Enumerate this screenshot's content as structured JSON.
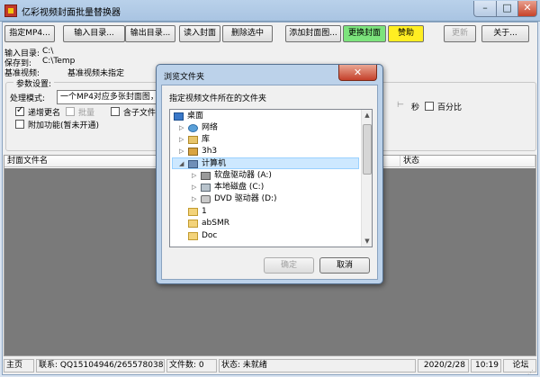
{
  "window": {
    "title": "亿彩视频封面批量替换器",
    "minimize_glyph": "–",
    "maximize_glyph": "□",
    "close_glyph": "✕"
  },
  "toolbar": {
    "buttons": [
      {
        "label": "指定MP4..."
      },
      {
        "label": "输入目录..."
      },
      {
        "label": "输出目录..."
      },
      {
        "label": "读入封面"
      },
      {
        "label": "删除选中"
      },
      {
        "label": "添加封面图..."
      },
      {
        "label": "更换封面",
        "color": "#7ce37c"
      },
      {
        "label": "赞助",
        "color": "#ffee22"
      },
      {
        "label": "更新",
        "disabled": true
      },
      {
        "label": "关于..."
      }
    ]
  },
  "paths": {
    "input_label": "输入目录:",
    "input_value": "C:\\",
    "output_label": "保存到:",
    "output_value": "C:\\Temp",
    "base_video_label": "基准视频:",
    "base_video_value": "基准视频未指定"
  },
  "settings": {
    "group_title": "参数设置:",
    "mode_label": "处理模式:",
    "mode_value": "一个MP4对应多张封面图，生",
    "auto_rename_label": "递增更名",
    "auto_rename_checked": true,
    "batch_label": "批量",
    "batch_checked": false,
    "include_subdirs_label": "含子文件夹",
    "include_subdirs_checked": false,
    "seconds_label": "秒",
    "percent_label": "百分比",
    "percent_checked": false,
    "addon_label": "附加功能(暂未开通)",
    "addon_checked": false
  },
  "list": {
    "columns": [
      "封面文件名",
      "状态"
    ]
  },
  "statusbar": {
    "home": "主页",
    "contact": "联系: QQ15104946/2655780380»",
    "file_count": "文件数: 0",
    "state": "状态: 未就绪",
    "date": "2020/2/28",
    "time": "10:19",
    "forum": "论坛"
  },
  "dialog": {
    "title": "浏览文件夹",
    "prompt": "指定视频文件所在的文件夹",
    "tree": [
      {
        "label": "桌面",
        "icon": "desktop-icon",
        "level": 0,
        "arrow": ""
      },
      {
        "label": "网络",
        "icon": "network-icon",
        "level": 1,
        "arrow": "▷"
      },
      {
        "label": "库",
        "icon": "library-icon",
        "level": 1,
        "arrow": "▷"
      },
      {
        "label": "3h3",
        "icon": "user-folder-icon",
        "level": 1,
        "arrow": "▷"
      },
      {
        "label": "计算机",
        "icon": "computer-icon",
        "level": 1,
        "arrow": "◢",
        "selected": true
      },
      {
        "label": "软盘驱动器 (A:)",
        "icon": "floppy-drive-icon",
        "level": 2,
        "arrow": "▷"
      },
      {
        "label": "本地磁盘 (C:)",
        "icon": "local-disk-icon",
        "level": 2,
        "arrow": "▷"
      },
      {
        "label": "DVD 驱动器 (D:)",
        "icon": "dvd-drive-icon",
        "level": 2,
        "arrow": "▷"
      },
      {
        "label": "1",
        "icon": "folder-icon",
        "level": 1,
        "arrow": ""
      },
      {
        "label": "abSMR",
        "icon": "folder-icon",
        "level": 1,
        "arrow": ""
      },
      {
        "label": "Doc",
        "icon": "folder-icon",
        "level": 1,
        "arrow": ""
      }
    ],
    "ok_label": "确定",
    "cancel_label": "取消"
  },
  "colors": {
    "list_body": "#7a7a7a",
    "dialog_frame": "#bcd2ea",
    "update_button": "#7ce37c",
    "donate_button": "#ffee22"
  }
}
